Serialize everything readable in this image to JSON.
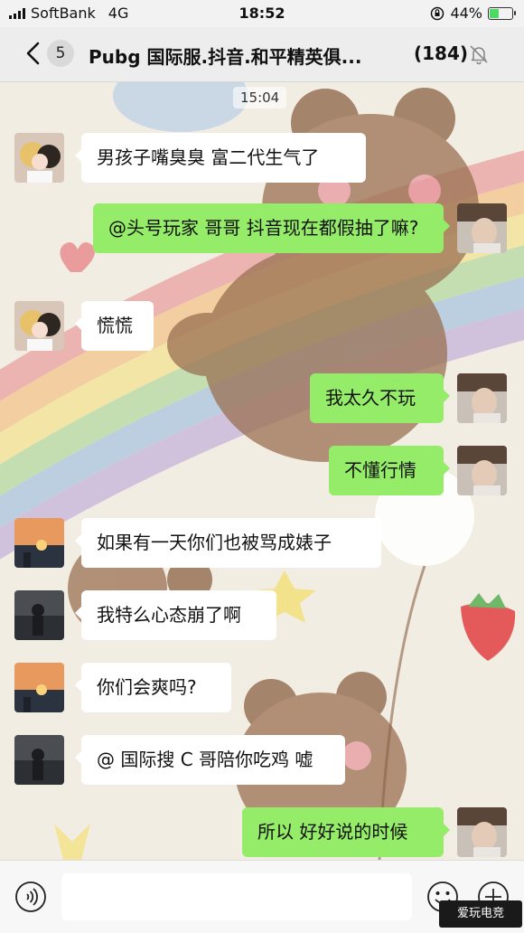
{
  "status_bar": {
    "carrier": "SoftBank",
    "network": "4G",
    "time": "18:52",
    "battery": "44%",
    "battery_level": 0.44
  },
  "header": {
    "back_badge": "5",
    "title": "Pubg 国际服.抖音.和平精英俱...",
    "member_count": "(184)"
  },
  "chat": {
    "timestamp": "15:04",
    "messages": [
      {
        "side": "in",
        "avatar": "girl-avatar",
        "text": "男孩子嘴臭臭 富二代生气了"
      },
      {
        "side": "out",
        "avatar": "self-avatar",
        "text": "@头号玩家 哥哥 抖音现在都假抽了嘛?"
      },
      {
        "side": "in",
        "avatar": "girl-avatar",
        "text": "慌慌"
      },
      {
        "side": "out",
        "avatar": "self-avatar",
        "text": "我太久不玩"
      },
      {
        "side": "out",
        "avatar": "self-avatar",
        "text": "不懂行情"
      },
      {
        "side": "in",
        "avatar": "sunset-avatar",
        "text": "如果有一天你们也被骂成婊子"
      },
      {
        "side": "in",
        "avatar": "dark-avatar",
        "text": "我特么心态崩了啊"
      },
      {
        "side": "in",
        "avatar": "sunset-avatar",
        "text": "你们会爽吗?"
      },
      {
        "side": "in",
        "avatar": "dark-avatar",
        "text": "@ 国际搜 C 哥陪你吃鸡 嘘"
      },
      {
        "side": "out",
        "avatar": "self-avatar",
        "text": "所以 好好说的时候"
      }
    ]
  },
  "input_bar": {
    "placeholder": ""
  },
  "watermark": {
    "text": "爱玩电竞"
  },
  "colors": {
    "outgoing_bubble": "#95ec69",
    "incoming_bubble": "#ffffff",
    "nav_background": "#ededed"
  }
}
